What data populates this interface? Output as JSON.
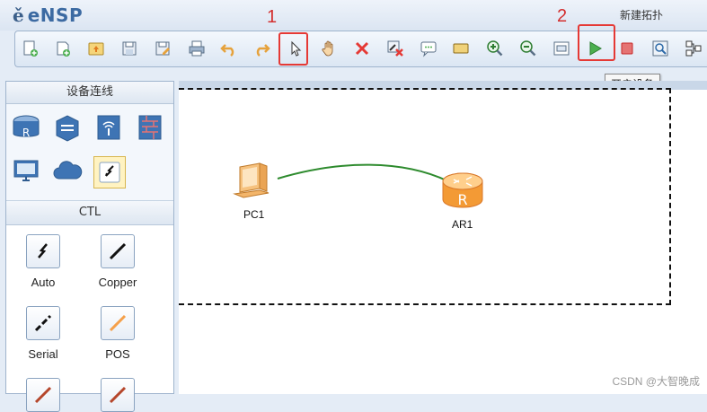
{
  "app": {
    "logo_mark": "ě",
    "logo_text": "eNSP",
    "topology_title": "新建拓扑"
  },
  "toolbar": {
    "buttons": [
      {
        "icon": "new-topology-icon"
      },
      {
        "icon": "new-file-icon"
      },
      {
        "icon": "open-folder-icon"
      },
      {
        "icon": "save-icon"
      },
      {
        "icon": "save-as-icon"
      },
      {
        "icon": "print-icon"
      },
      {
        "icon": "undo-icon"
      },
      {
        "icon": "redo-icon"
      },
      {
        "icon": "select-pointer-icon"
      },
      {
        "icon": "hand-pan-icon"
      },
      {
        "icon": "delete-icon"
      },
      {
        "icon": "delete-link-icon"
      },
      {
        "icon": "text-comment-icon"
      },
      {
        "icon": "rectangle-icon"
      },
      {
        "icon": "zoom-in-icon"
      },
      {
        "icon": "zoom-out-icon"
      },
      {
        "icon": "fit-view-icon"
      },
      {
        "icon": "start-device-icon"
      },
      {
        "icon": "stop-device-icon"
      },
      {
        "icon": "capture-icon"
      },
      {
        "icon": "topology-icon"
      }
    ],
    "tooltip": "开启设备"
  },
  "annotations": {
    "first": "1",
    "second": "2"
  },
  "sidebar": {
    "header": "设备连线",
    "devices": [
      {
        "icon": "router-icon"
      },
      {
        "icon": "switch-icon"
      },
      {
        "icon": "wireless-icon"
      },
      {
        "icon": "firewall-icon"
      },
      {
        "icon": "pc-terminal-icon"
      },
      {
        "icon": "cloud-icon"
      },
      {
        "icon": "connection-icon"
      }
    ],
    "ctl_header": "CTL",
    "cables": [
      {
        "label": "Auto",
        "color": "#111111"
      },
      {
        "label": "Copper",
        "color": "#111111"
      },
      {
        "label": "Serial",
        "color": "#111111"
      },
      {
        "label": "POS",
        "color": "#f5a04a"
      }
    ]
  },
  "canvas": {
    "nodes": [
      {
        "label": "PC1"
      },
      {
        "label": "AR1"
      }
    ],
    "link_color": "#2e8b2e"
  },
  "watermark": "CSDN @大智晚成"
}
